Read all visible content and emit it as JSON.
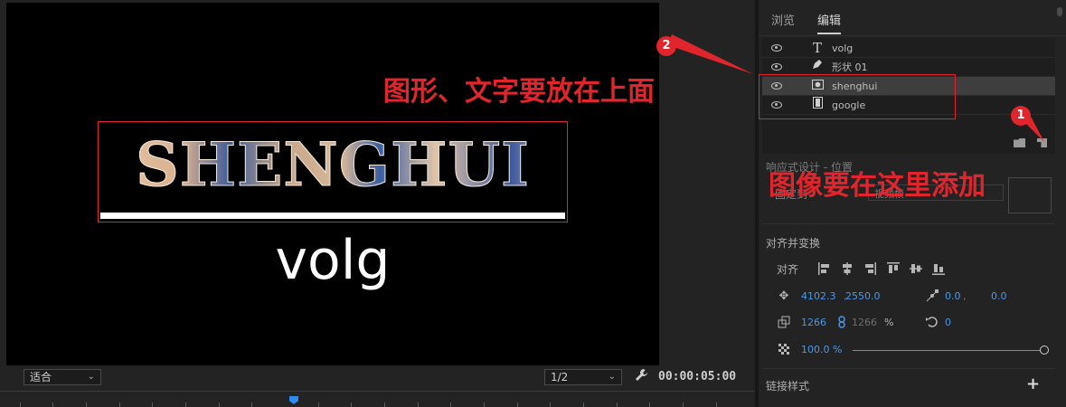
{
  "monitor": {
    "title_text": "SHENGHUI",
    "sub_text": "volg",
    "fit_select": "适合",
    "res_select": "1/2",
    "timecode": "00:00:05:00",
    "annotation_top": "图形、文字要放在上面"
  },
  "panel": {
    "tabs": [
      {
        "label": "浏览"
      },
      {
        "label": "编辑"
      }
    ],
    "layers": [
      {
        "icon": "text-icon",
        "name": "volg"
      },
      {
        "icon": "pen-icon",
        "name": "形状 01"
      },
      {
        "icon": "image-icon",
        "name": "shenghui"
      },
      {
        "icon": "film-icon",
        "name": "google"
      }
    ],
    "annotation_side": "图像要在这里添加",
    "responsive_label": "响应式设计 - 位置",
    "pin_label": "固定到",
    "pin_value": "视频帧",
    "align_section": "对齐并变换",
    "align_label": "对齐",
    "position_x": "4102.3",
    "position_sep": ",",
    "position_y": "2550.0",
    "anchor_x": "0.0",
    "anchor_sep": ",",
    "anchor_y": "0.0",
    "scale_w": "1266",
    "scale_h": "1266",
    "scale_unit": "%",
    "rotation": "0",
    "opacity": "100.0 %",
    "link_styles": "链接样式",
    "add_label": "+"
  },
  "badges": {
    "one": "1",
    "two": "2"
  },
  "colors": {
    "accent_blue": "#4a98e6",
    "annot_red": "#e0262c"
  }
}
